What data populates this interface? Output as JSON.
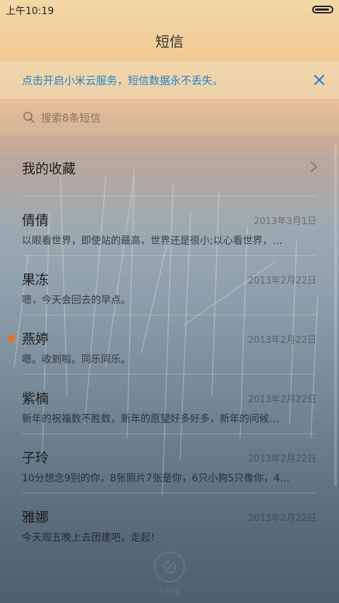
{
  "status": {
    "time": "上午10:19",
    "battery_level": 0.9
  },
  "header": {
    "title": "短信"
  },
  "banner": {
    "text": "点击开启小米云服务，短信数据永不丢失。",
    "close_icon": "close-icon",
    "accent": "#1f84d6"
  },
  "search": {
    "placeholder": "搜索8条短信",
    "icon": "search-icon"
  },
  "favorites": {
    "label": "我的收藏",
    "icon": "chevron-right-icon"
  },
  "conversations": [
    {
      "name": "倩倩",
      "date": "2013年3月1日",
      "preview": "以眼看世界，即使站的最高，世界还是很小;以心看世界，…",
      "unread": false
    },
    {
      "name": "果冻",
      "date": "2013年2月22日",
      "preview": "嗯，今天会回去的早点。",
      "unread": false
    },
    {
      "name": "燕婷",
      "date": "2013年2月22日",
      "preview": "嗯。收到啦。同乐同乐。",
      "unread": true
    },
    {
      "name": "紫楠",
      "date": "2013年2月22日",
      "preview": "新年的祝福数不胜数，新年的愿望好多好多，新年的问候…",
      "unread": false
    },
    {
      "name": "子玲",
      "date": "2013年2月22日",
      "preview": "10分想念9别的你，8张照片7张是你，6只小狗5只像你，4…",
      "unread": false
    },
    {
      "name": "雅娜",
      "date": "2013年2月22日",
      "preview": "今天周五晚上去团建吧，走起！",
      "unread": false
    }
  ],
  "compose": {
    "label": "写短信",
    "icon": "compose-icon"
  },
  "colors": {
    "unread_dot": "#f06d1e",
    "link": "#1f84d6"
  }
}
